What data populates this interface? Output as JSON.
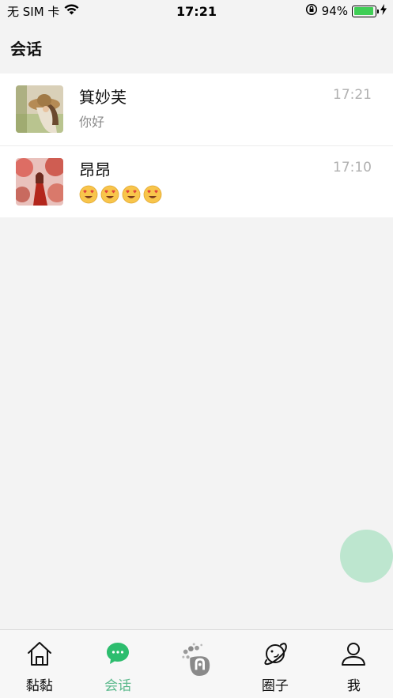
{
  "status": {
    "carrier": "无 SIM 卡",
    "time": "17:21",
    "battery_percent": "94%",
    "battery_level": 0.94
  },
  "header": {
    "title": "会话"
  },
  "conversations": [
    {
      "name": "箕妙芙",
      "message": "你好",
      "time": "17:21",
      "avatar": "avatar-woman-hat"
    },
    {
      "name": "昂昂",
      "message_emoji": [
        "heart-eyes",
        "heart-eyes",
        "heart-eyes",
        "heart-eyes"
      ],
      "time": "17:10",
      "avatar": "avatar-woman-red-dress"
    }
  ],
  "tabs": [
    {
      "label": "黏黏",
      "icon": "home-icon",
      "active": false
    },
    {
      "label": "会话",
      "icon": "chat-bubble-icon",
      "active": true
    },
    {
      "label": "",
      "icon": "app-logo-icon",
      "active": false
    },
    {
      "label": "圈子",
      "icon": "planet-icon",
      "active": false
    },
    {
      "label": "我",
      "icon": "person-icon",
      "active": false
    }
  ],
  "colors": {
    "accent": "#5bb98c",
    "fab": "#bde6cf",
    "battery": "#3fce55"
  }
}
